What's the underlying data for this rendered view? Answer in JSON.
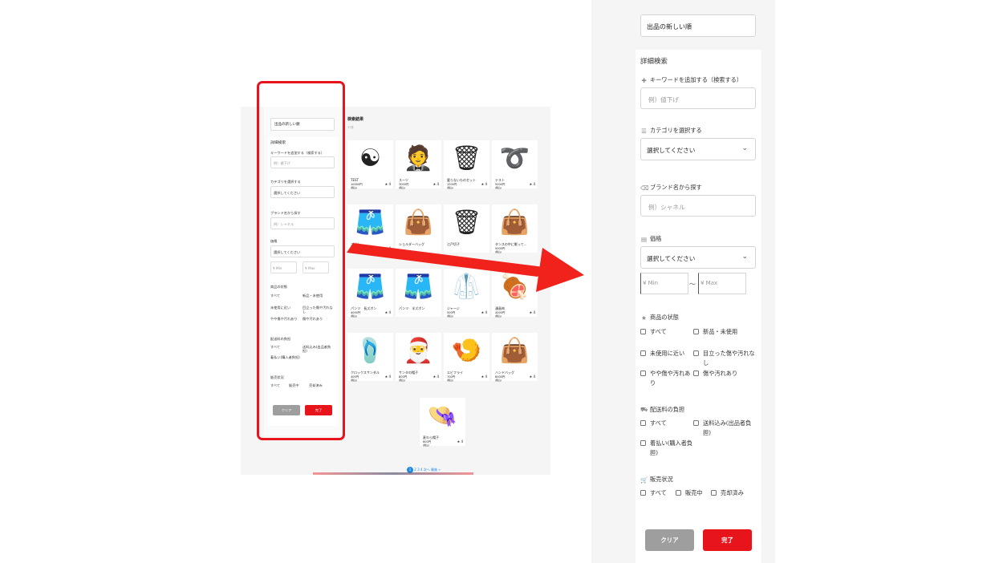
{
  "thumbnail": {
    "sort_label": "出品の新しい順",
    "panel": {
      "title": "詳細検索",
      "keyword_label": "キーワードを追加する（検索する）",
      "keyword_placeholder": "例）値下げ",
      "category_label": "カテゴリを選択する",
      "category_value": "選択してください",
      "brand_label": "ブランド名から探す",
      "brand_placeholder": "例）シャネル",
      "price_label": "価格",
      "price_value": "選択してください",
      "min": "¥ Min",
      "max": "¥ Max",
      "condition_label": "商品の状態",
      "condition_options": [
        "すべて",
        "新品・未使用",
        "未使用に近い",
        "目立った傷や汚れなし",
        "やや傷や汚れあり",
        "傷や汚れあり"
      ],
      "shipping_label": "配送料の負担",
      "shipping_options": [
        "すべて",
        "送料込み(出品者負担)",
        "着払い(購入者負担)"
      ],
      "sales_label": "販売状況",
      "sales_options": [
        "すべて",
        "販売中",
        "売却済み"
      ],
      "clear": "クリア",
      "done": "完了"
    },
    "results_title": "検索結果",
    "results_count": "17件",
    "items": [
      {
        "name": "TEST",
        "price": "10000円",
        "tax": "(税込)",
        "stars": "★ 4",
        "icon": "yin-yang-icon",
        "emoji": "☯"
      },
      {
        "name": "スーツ",
        "price": "3000円",
        "tax": "(税込)",
        "stars": "★ 4",
        "icon": "suit-icon",
        "emoji": "🤵"
      },
      {
        "name": "要らないものセット",
        "price": "1200円",
        "tax": "(税込)",
        "stars": "★ 4",
        "icon": "trash-bin-icon",
        "emoji": "🗑"
      },
      {
        "name": "テスト",
        "price": "5000円",
        "tax": "(税込)",
        "stars": "★ 4",
        "icon": "belt-icon",
        "emoji": "➰"
      },
      {
        "name": "ズボン",
        "price": "500円",
        "tax": "(税込)",
        "stars": "★ 4",
        "icon": "shorts-icon",
        "emoji": "🩳"
      },
      {
        "name": "ショルダーバッグ",
        "price": "",
        "tax": "",
        "stars": "",
        "icon": "bag-icon",
        "emoji": "👜"
      },
      {
        "name": "江戸切子",
        "price": "",
        "tax": "",
        "stars": "",
        "icon": "trash-bin-icon",
        "emoji": "🗑"
      },
      {
        "name": "タンスの中に眠って...",
        "price": "5000円",
        "tax": "(税込)",
        "stars": "",
        "icon": "bag-icon",
        "emoji": "👜"
      },
      {
        "name": "パンツ　長ズボン",
        "price": "4000円",
        "tax": "(税込)",
        "stars": "★ 4",
        "icon": "shorts-icon",
        "emoji": "🩳"
      },
      {
        "name": "パンツ　半ズボン",
        "price": "",
        "tax": "",
        "stars": "",
        "icon": "shorts-icon",
        "emoji": "🩳"
      },
      {
        "name": "ジャージ",
        "price": "500円",
        "tax": "(税込)",
        "stars": "★ 4",
        "icon": "jersey-icon",
        "emoji": "🥼"
      },
      {
        "name": "漫画肉",
        "price": "4000円",
        "tax": "(税込)",
        "stars": "★ 4",
        "icon": "meat-icon",
        "emoji": "🍖"
      },
      {
        "name": "クロックスサンダル",
        "price": "400円",
        "tax": "(税込)",
        "stars": "★ 4",
        "icon": "sandal-icon",
        "emoji": "🩴"
      },
      {
        "name": "サンタの帽子",
        "price": "800円",
        "tax": "(税込)",
        "stars": "★ 4",
        "icon": "santa-hat-icon",
        "emoji": "🎅"
      },
      {
        "name": "エビフライ",
        "price": "700円",
        "tax": "(税込)",
        "stars": "★ 4",
        "icon": "fried-shrimp-icon",
        "emoji": "🍤"
      },
      {
        "name": "ハンドバッグ",
        "price": "8000円",
        "tax": "(税込)",
        "stars": "★ 4",
        "icon": "bag-icon",
        "emoji": "👜"
      },
      {
        "name": "麦わら帽子",
        "price": "600円",
        "tax": "(税込)",
        "stars": "★ 4",
        "icon": "straw-hat-icon",
        "emoji": "👒"
      }
    ],
    "pagination": [
      "1",
      "2",
      "3",
      "4",
      "次へ",
      "最後 »"
    ]
  },
  "filter_panel": {
    "sort_label": "出品の新しい順",
    "title": "詳細検索",
    "keyword": {
      "icon": "plus-icon",
      "label": "キーワードを追加する（検索する）",
      "placeholder": "例）値下げ"
    },
    "category": {
      "icon": "list-icon",
      "label": "カテゴリを選択する",
      "value": "選択してください"
    },
    "brand": {
      "icon": "tag-icon",
      "label": "ブランド名から探す",
      "placeholder": "例）シャネル"
    },
    "price": {
      "icon": "coins-icon",
      "label": "価格",
      "value": "選択してください",
      "min_placeholder": "¥ Min",
      "separator": "〜",
      "max_placeholder": "¥ Max"
    },
    "condition": {
      "icon": "star-icon",
      "label": "商品の状態",
      "options": [
        "すべて",
        "新品・未使用",
        "未使用に近い",
        "目立った傷や汚れなし",
        "やや傷や汚れあり",
        "傷や汚れあり"
      ]
    },
    "shipping": {
      "icon": "truck-icon",
      "label": "配送料の負担",
      "options": [
        "すべて",
        "送料込み(出品者負担)",
        "着払い(購入者負担)"
      ]
    },
    "sales": {
      "icon": "cart-icon",
      "label": "販売状況",
      "options": [
        "すべて",
        "販売中",
        "売却済み"
      ]
    },
    "clear_label": "クリア",
    "done_label": "完了"
  },
  "colors": {
    "highlight": "#e8141c",
    "arrow": "#f0221b",
    "done_button": "#e8141c",
    "clear_button": "#9e9e9e",
    "accent": "#1e88e5"
  }
}
